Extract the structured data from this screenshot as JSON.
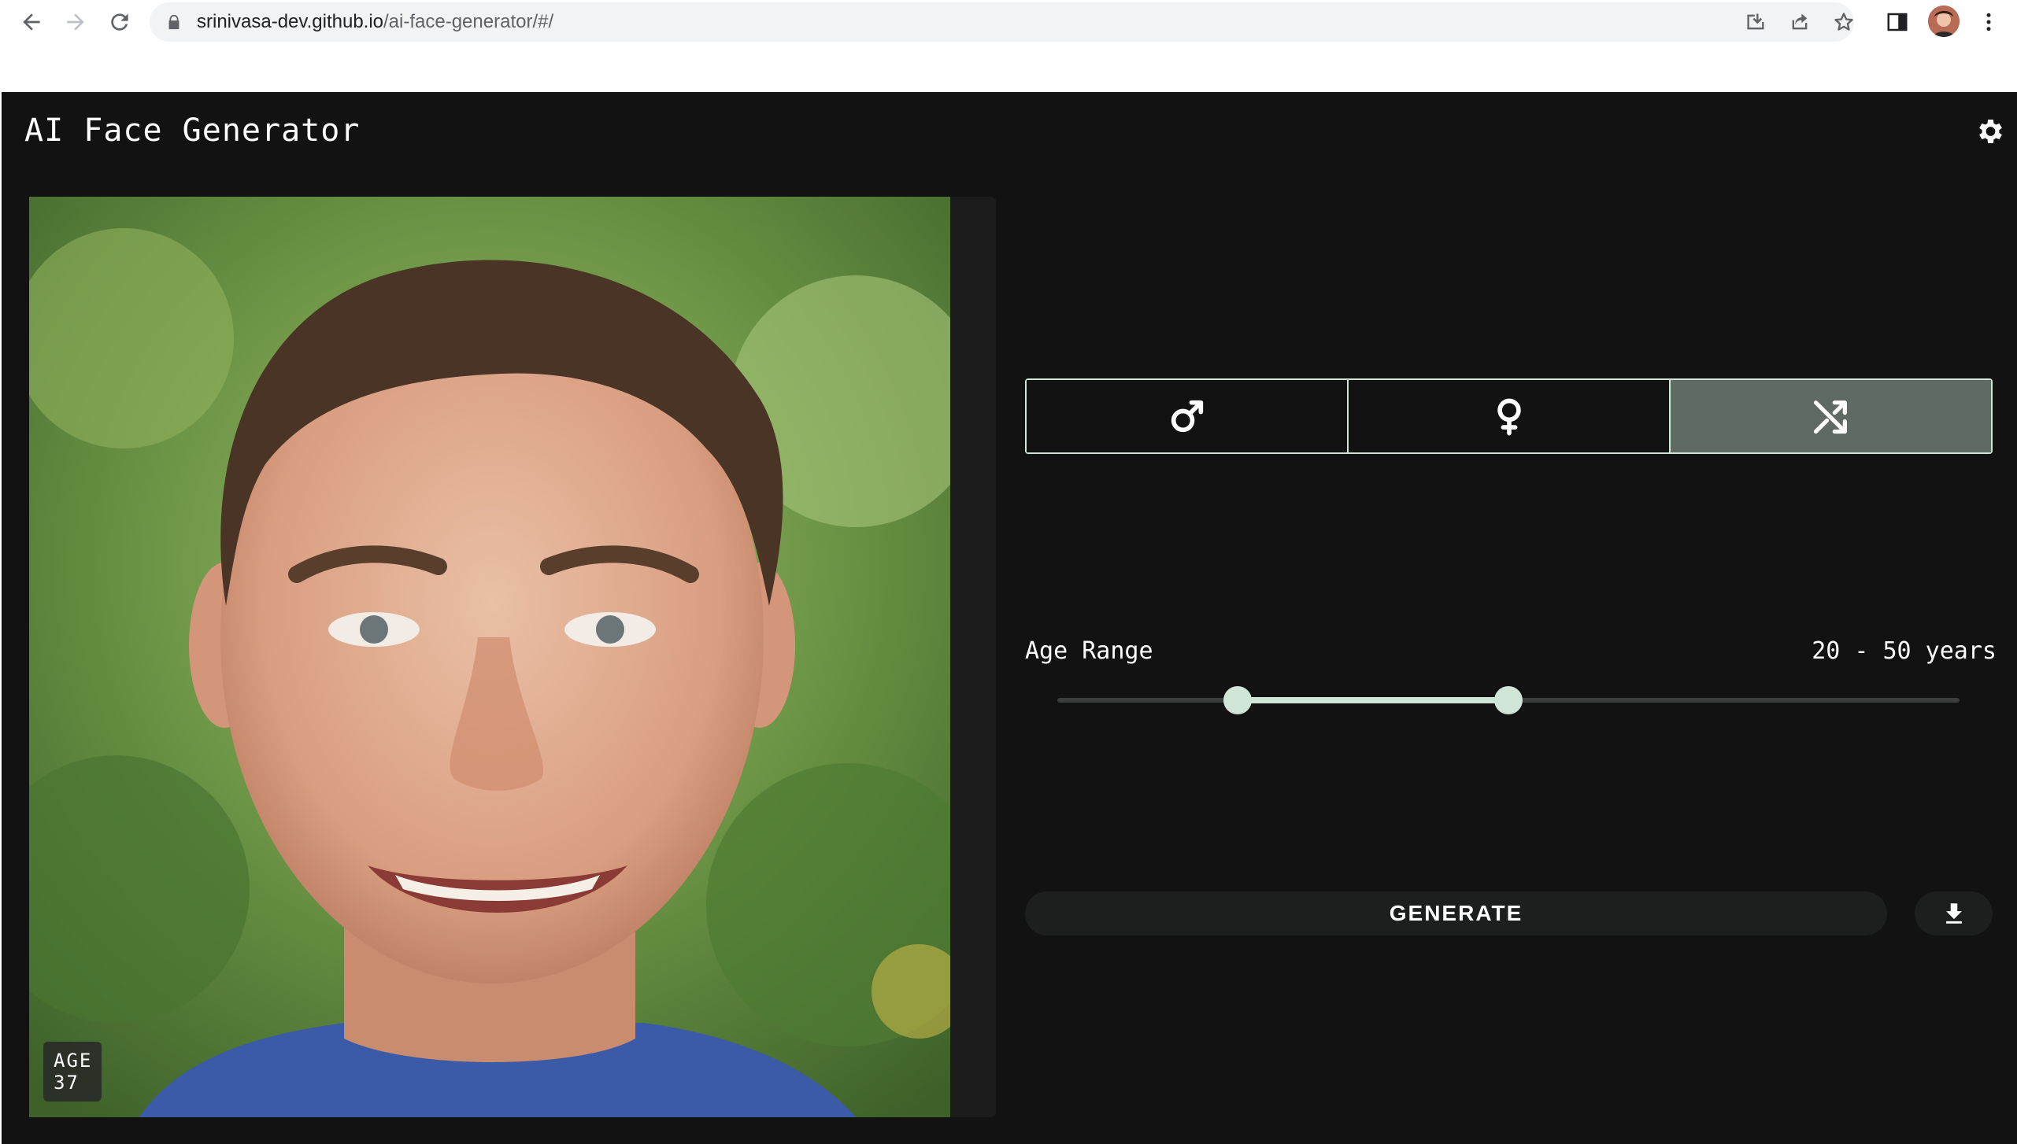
{
  "browser": {
    "url_host": "srinivasa-dev.github.io",
    "url_path": "/ai-face-generator/#/",
    "icons": [
      "back-arrow-icon",
      "forward-arrow-icon",
      "reload-icon",
      "lock-icon",
      "install-icon",
      "share-icon",
      "star-icon",
      "side-panel-icon",
      "profile-avatar",
      "kebab-menu-icon"
    ]
  },
  "app": {
    "title": "AI Face Generator",
    "settings_icon": "gear-icon",
    "photo": {
      "age_label": "AGE",
      "age_value": "37"
    },
    "gender": {
      "options": [
        {
          "name": "male",
          "icon": "male-symbol-icon",
          "selected": false
        },
        {
          "name": "female",
          "icon": "female-symbol-icon",
          "selected": false
        },
        {
          "name": "random",
          "icon": "shuffle-icon",
          "selected": true
        }
      ]
    },
    "age_range": {
      "label": "Age Range",
      "value_text": "20 - 50 years",
      "min": 20,
      "max": 50,
      "slider_min_fraction": 0.2,
      "slider_max_fraction": 0.5
    },
    "generate_label": "GENERATE",
    "download_icon": "download-icon"
  },
  "colors": {
    "background": "#121212",
    "accent": "#cfe5d8",
    "selected_toggle": "#5f6a64",
    "button_bg": "#1d1f1e"
  }
}
